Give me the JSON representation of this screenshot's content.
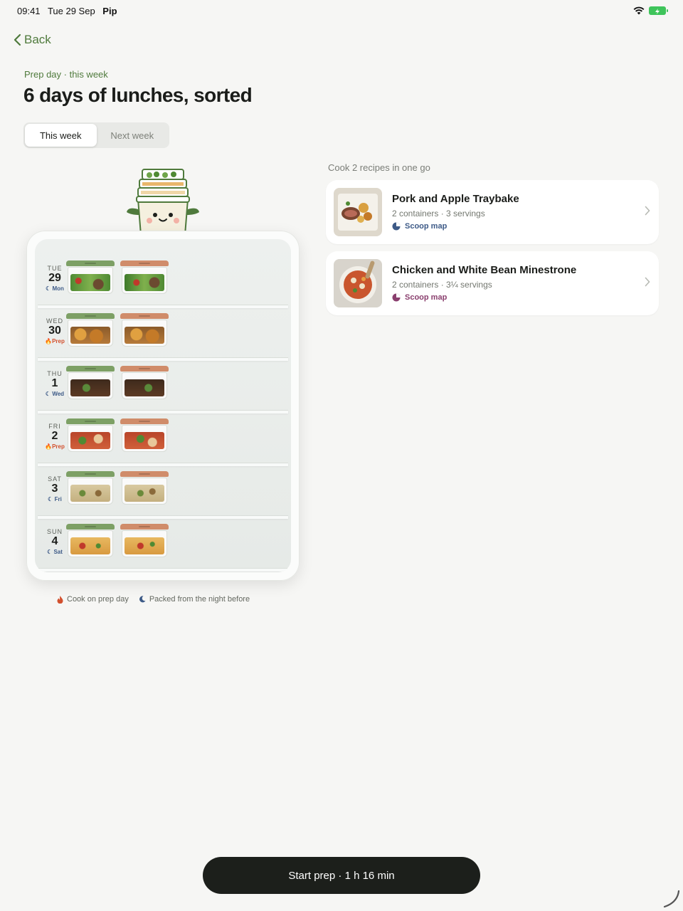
{
  "status": {
    "time": "09:41",
    "date": "Tue 29 Sep",
    "app": "Pip"
  },
  "nav": {
    "back_label": "Back"
  },
  "header": {
    "eyebrow": "Prep day · this week",
    "title": "6 days of lunches, sorted"
  },
  "segment": {
    "options": [
      "This week",
      "Next week"
    ],
    "selected": "This week"
  },
  "fridge": {
    "shelves": [
      {
        "dow": "TUE",
        "num": "29",
        "tag": "Mon",
        "tag_type": "night",
        "food": [
          "salad",
          "salad"
        ]
      },
      {
        "dow": "WED",
        "num": "30",
        "tag": "Prep",
        "tag_type": "prep",
        "food": [
          "potato",
          "potato"
        ]
      },
      {
        "dow": "THU",
        "num": "1",
        "tag": "Wed",
        "tag_type": "night",
        "food": [
          "beef",
          "beef"
        ]
      },
      {
        "dow": "FRI",
        "num": "2",
        "tag": "Prep",
        "tag_type": "prep",
        "food": [
          "stew",
          "stew"
        ]
      },
      {
        "dow": "SAT",
        "num": "3",
        "tag": "Fri",
        "tag_type": "night",
        "food": [
          "grain",
          "grain"
        ]
      },
      {
        "dow": "SUN",
        "num": "4",
        "tag": "Sat",
        "tag_type": "night",
        "food": [
          "pasta",
          "pasta"
        ]
      }
    ]
  },
  "legend": {
    "prep": "Cook on prep day",
    "night": "Packed from the night before"
  },
  "recipes": {
    "label": "Cook 2 recipes in one go",
    "items": [
      {
        "name": "Pork and Apple Traybake",
        "meta": "2 containers · 3 servings",
        "link": "Scoop map",
        "link_color": "#3d5a87"
      },
      {
        "name": "Chicken and White Bean Minestrone",
        "meta": "2 containers · 3¼ servings",
        "link": "Scoop map",
        "link_color": "#8a3f6e"
      }
    ]
  },
  "cta": {
    "label": "Start prep · 1 h 16 min"
  },
  "colors": {
    "accent": "#4f7a3c",
    "prep": "#d2502e",
    "night": "#3d5a87",
    "lid_green": "#7da065",
    "lid_orange": "#d08c6a"
  }
}
